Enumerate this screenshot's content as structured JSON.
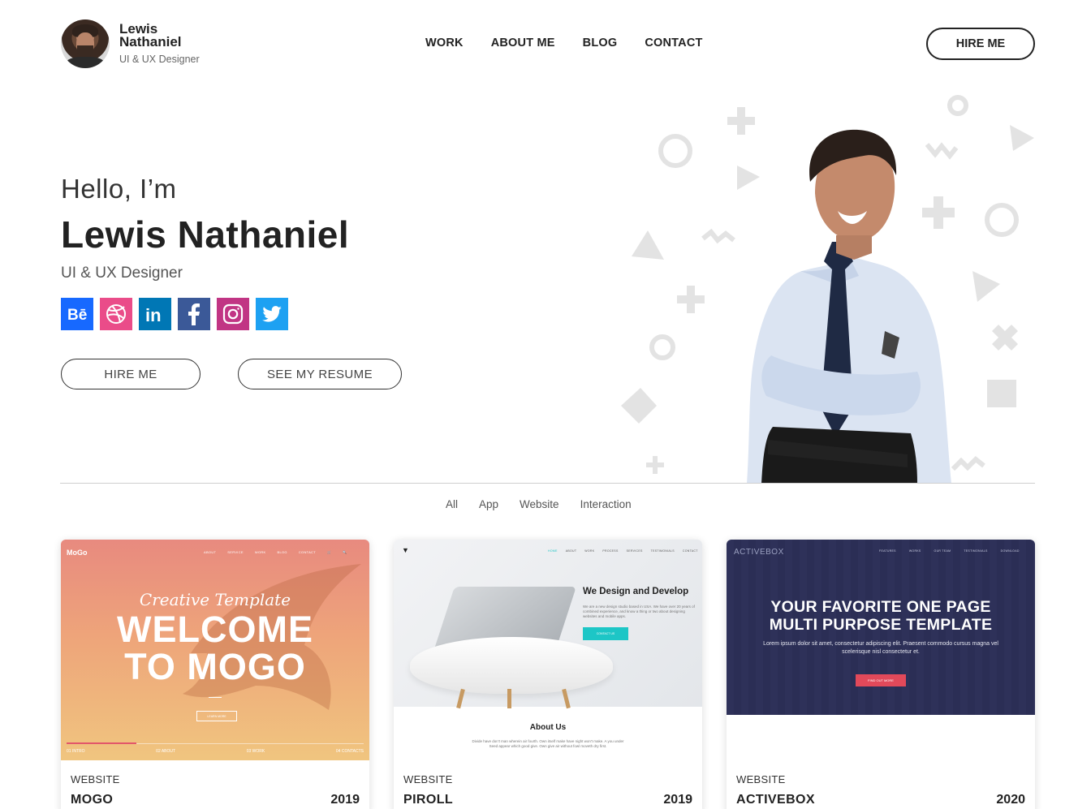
{
  "brand": {
    "name": "Lewis Nathaniel",
    "role": "UI & UX Designer"
  },
  "nav": {
    "items": [
      "WORK",
      "ABOUT ME",
      "BLOG",
      "CONTACT"
    ],
    "hire_label": "HIRE ME"
  },
  "hero": {
    "greeting": "Hello, I’m",
    "name": "Lewis Nathaniel",
    "role": "UI & UX Designer",
    "socials": [
      {
        "icon": "behance-icon",
        "color": "#1769ff"
      },
      {
        "icon": "dribbble-icon",
        "color": "#ea4c89"
      },
      {
        "icon": "linkedin-icon",
        "color": "#0077b5"
      },
      {
        "icon": "facebook-icon",
        "color": "#3b5998"
      },
      {
        "icon": "instagram-icon",
        "color": "#c13584"
      },
      {
        "icon": "twitter-icon",
        "color": "#1da1f2"
      }
    ],
    "hire_button": "HIRE ME",
    "resume_button": "SEE MY RESUME"
  },
  "filters": [
    "All",
    "App",
    "Website",
    "Interaction"
  ],
  "projects": [
    {
      "category": "WEBSITE",
      "title": "MOGO",
      "year": "2019",
      "preview": {
        "logo": "MoGo",
        "nav": [
          "ABOUT",
          "SERVICE",
          "WORK",
          "BLOG",
          "CONTACT"
        ],
        "script": "Creative Template",
        "headline_1": "WELCOME",
        "headline_2": "TO MOGO",
        "button": "LEARN MORE",
        "steps": [
          "01 INTRO",
          "02 ABOUT",
          "03 WORK",
          "04 CONTACTS"
        ]
      }
    },
    {
      "category": "WEBSITE",
      "title": "PIROLL",
      "year": "2019",
      "preview": {
        "nav": [
          "HOME",
          "ABOUT",
          "WORK",
          "PROCESS",
          "SERVICES",
          "TESTIMONIALS",
          "CONTACT"
        ],
        "headline": "We Design and Develop",
        "paragraph": "We are a new design studio based in USA. We have over 20 years of combined experience, and know a thing or two about designing websites and mobile apps.",
        "button": "CONTACT US",
        "about_title": "About Us",
        "about_text": "Divide have don't man wherein air fourth. Own itself make have night won't make. A you under Seed appear which good give. Own give air without fowl moveth dry first."
      },
      "accent": "#1dc6c6"
    },
    {
      "category": "WEBSITE",
      "title": "ACTIVEBOX",
      "year": "2020",
      "preview": {
        "logo": "ACTIVEBOX",
        "nav": [
          "FEATURES",
          "WORKS",
          "OUR TEAM",
          "TESTIMONIALS",
          "DOWNLOAD"
        ],
        "headline_1": "YOUR FAVORITE ONE PAGE",
        "headline_2": "MULTI PURPOSE TEMPLATE",
        "paragraph": "Lorem ipsum dolor sit amet, consectetur adipiscing elit. Praesent commodo cursus magna vel scelerisque nisl consectetur et.",
        "button": "FIND OUT MORE"
      },
      "accent": "#e2495a"
    }
  ]
}
